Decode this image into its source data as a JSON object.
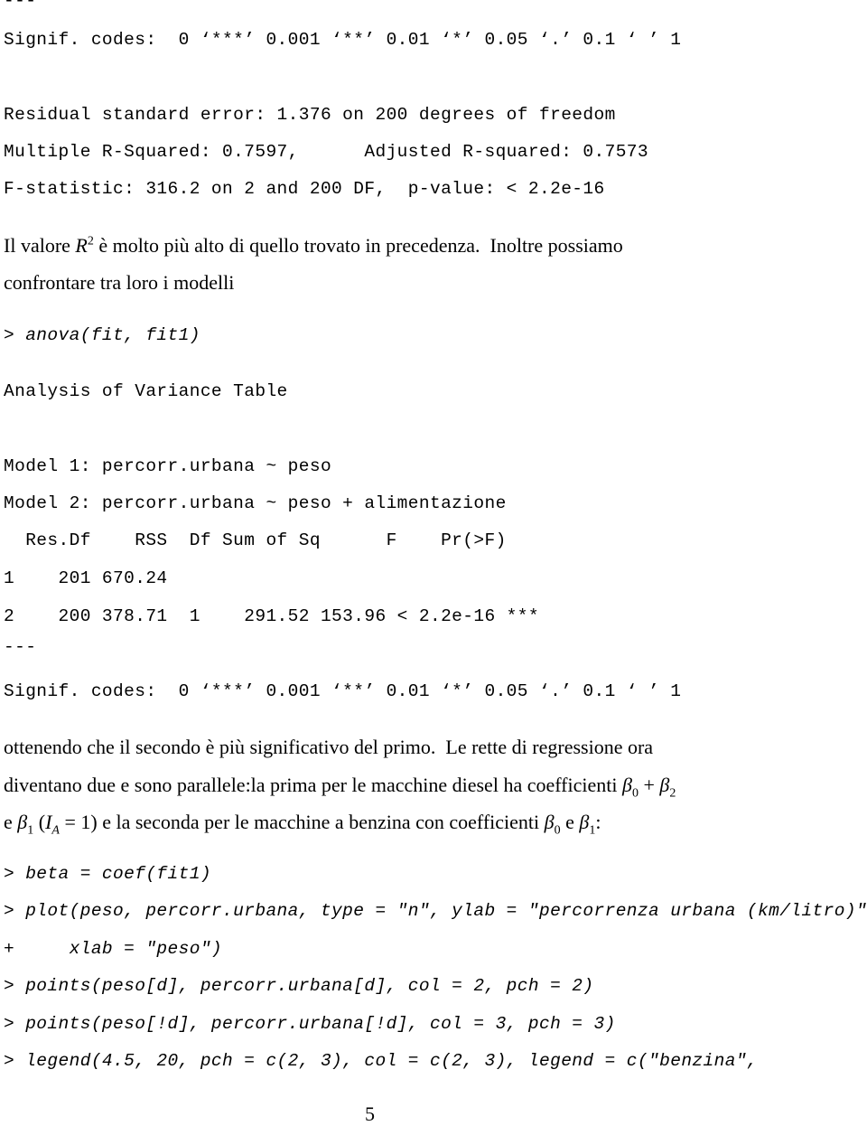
{
  "r_output_top": {
    "separator": "---",
    "signif_codes": "Signif. codes:  0 ‘***’ 0.001 ‘**’ 0.01 ‘*’ 0.05 ‘.’ 0.1 ‘ ’ 1",
    "residual_se": "Residual standard error: 1.376 on 200 degrees of freedom",
    "r_squared": "Multiple R-Squared: 0.7597,      Adjusted R-squared: 0.7573",
    "f_statistic": "F-statistic: 316.2 on 2 and 200 DF,  p-value: < 2.2e-16"
  },
  "paragraph1": {
    "part1": "Il valore ",
    "math_R": "R",
    "sup_2": "2",
    "part2": " è molto più alto di quello trovato in precedenza.  Inoltre possiamo",
    "line2": "confrontare tra loro i modelli"
  },
  "cmd_anova": "> anova(fit, fit1)",
  "anova": {
    "title": "Analysis of Variance Table",
    "model1": "Model 1: percorr.urbana ~ peso",
    "model2": "Model 2: percorr.urbana ~ peso + alimentazione",
    "header": "  Res.Df    RSS  Df Sum of Sq      F    Pr(>F)",
    "columns": [
      "Res.Df",
      "RSS",
      "Df",
      "Sum of Sq",
      "F",
      "Pr(>F)"
    ],
    "rows": [
      {
        "text": "1    201 670.24",
        "cells": [
          "1",
          "201",
          "670.24",
          "",
          "",
          "",
          ""
        ]
      },
      {
        "text": "2    200 378.71  1    291.52 153.96 < 2.2e-16 ***",
        "cells": [
          "2",
          "200",
          "378.71",
          "1",
          "291.52",
          "153.96",
          "< 2.2e-16 ***"
        ]
      }
    ],
    "separator": "---",
    "signif_codes": "Signif. codes:  0 ‘***’ 0.001 ‘**’ 0.01 ‘*’ 0.05 ‘.’ 0.1 ‘ ’ 1"
  },
  "paragraph2": {
    "line1": "ottenendo che il secondo è più significativo del primo.  Le rette di regressione ora",
    "line2_text": "diventano due e sono parallele:la prima per le macchine diesel ha coefficienti ",
    "beta": "β",
    "sub0": "0",
    "sub1": "1",
    "sub2": "2",
    "plus": " + ",
    "line3_e": "e ",
    "line3_paren_open": " (",
    "I": "I",
    "subA": "A",
    "eq1": " = 1)",
    "line3_mid": " e la seconda per le macchine a benzina con coefficienti ",
    "line3_e2": " e ",
    "colon": ":"
  },
  "commands": [
    "> beta = coef(fit1)",
    "> plot(peso, percorr.urbana, type = \"n\", ylab = \"percorrenza urbana (km/litro)\",",
    "+     xlab = \"peso\")",
    "> points(peso[d], percorr.urbana[d], col = 2, pch = 2)",
    "> points(peso[!d], percorr.urbana[!d], col = 3, pch = 3)",
    "> legend(4.5, 20, pch = c(2, 3), col = c(2, 3), legend = c(\"benzina\","
  ],
  "page_number": "5"
}
